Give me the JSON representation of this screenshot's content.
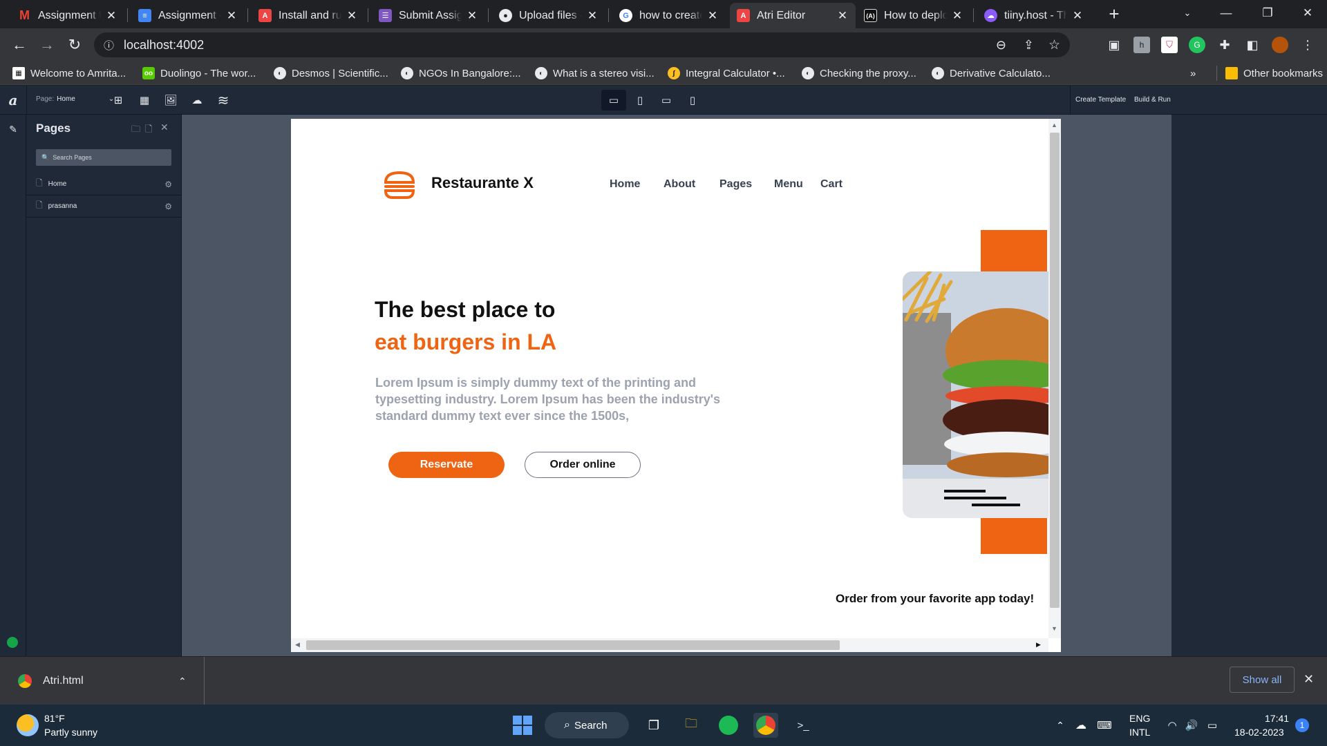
{
  "browser": {
    "tabs": [
      {
        "title": "Assignment fo",
        "icon": "gmail-icon",
        "color": "#ea4335"
      },
      {
        "title": "Assignment - ",
        "icon": "google-docs-icon",
        "color": "#4285f4"
      },
      {
        "title": "Install and run",
        "icon": "atri-icon",
        "color": "#ef4444"
      },
      {
        "title": "Submit Assign",
        "icon": "google-forms-icon",
        "color": "#7e57c2"
      },
      {
        "title": "Upload files - ",
        "icon": "github-icon",
        "color": "#e8eaed"
      },
      {
        "title": "how to create",
        "icon": "google-icon",
        "color": "#ffffff"
      },
      {
        "title": "Atri Editor",
        "icon": "atri-icon",
        "color": "#ef4444"
      },
      {
        "title": "How to deplo",
        "icon": "atri-docs-icon",
        "color": "#111111"
      },
      {
        "title": "tiiny.host - Th",
        "icon": "tiiny-host-icon",
        "color": "#8b5cf6"
      }
    ],
    "url": "localhost:4002",
    "bookmarks": [
      {
        "label": "Welcome to Amrita...",
        "icon": "amrita-icon"
      },
      {
        "label": "Duolingo - The wor...",
        "icon": "duolingo-icon"
      },
      {
        "label": "Desmos | Scientific...",
        "icon": "globe-icon"
      },
      {
        "label": "NGOs In Bangalore:...",
        "icon": "globe-icon"
      },
      {
        "label": "What is a stereo visi...",
        "icon": "globe-icon"
      },
      {
        "label": "Integral Calculator •...",
        "icon": "integral-icon"
      },
      {
        "label": "Checking the proxy...",
        "icon": "globe-icon"
      },
      {
        "label": "Derivative Calculato...",
        "icon": "globe-icon"
      }
    ],
    "bookmarks_more": "»",
    "other_bookmarks": "Other bookmarks"
  },
  "editor": {
    "logo": "a",
    "page_label": "Page:",
    "page_value": "Home",
    "create_template": "Create Template",
    "build_run": "Build & Run",
    "pages_title": "Pages",
    "search_placeholder": "Search Pages",
    "pages": [
      {
        "name": "Home"
      },
      {
        "name": "prasanna"
      }
    ]
  },
  "site": {
    "brand": "Restaurante X",
    "nav": [
      "Home",
      "About",
      "Pages",
      "Menu",
      "Cart"
    ],
    "headline_1": "The best place to",
    "headline_2": "eat burgers in LA",
    "body": "Lorem Ipsum is simply dummy text of the printing and typesetting industry. Lorem Ipsum has been the industry's standard dummy text ever since the 1500s,",
    "btn_primary": "Reservate",
    "btn_secondary": "Order online",
    "order_app": "Order from your favorite app today!",
    "accent_color": "#ef6412"
  },
  "downloads": {
    "file": "Atri.html",
    "show_all": "Show all"
  },
  "taskbar": {
    "temp": "81°F",
    "weather": "Partly sunny",
    "search": "Search",
    "lang_1": "ENG",
    "lang_2": "INTL",
    "time": "17:41",
    "date": "18-02-2023",
    "notif_count": "1"
  }
}
